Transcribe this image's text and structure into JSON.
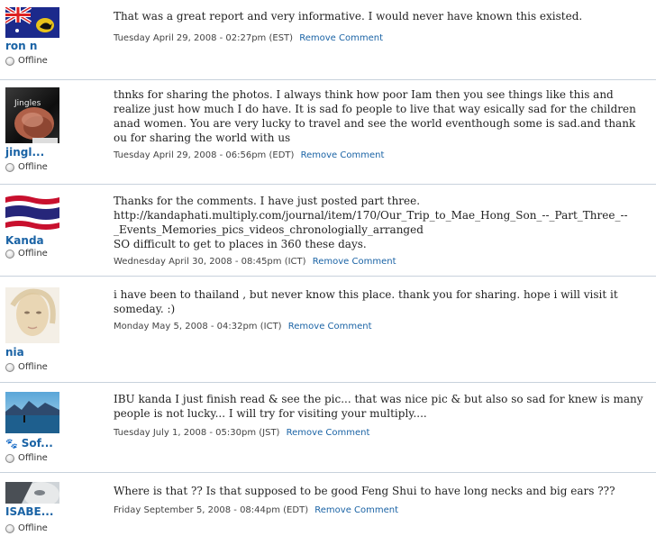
{
  "comments": [
    {
      "username": "ron n",
      "status": "Offline",
      "text": "That was a great report and very informative. I would never have known this existed.",
      "timestamp": "Tuesday April 29, 2008 - 02:27pm (EST)",
      "action": "Remove Comment"
    },
    {
      "username": "jingl...",
      "status": "Offline",
      "text": "thnks for sharing the photos. I always think how poor Iam then you see things like this and realize just how much I do have. It is sad fo people to live that way esically sad for the children anad women. You are very lucky to travel and see the world eventhough some is sad.and thank ou for sharing the world with us",
      "timestamp": "Tuesday April 29, 2008 - 06:56pm (EDT)",
      "action": "Remove Comment",
      "avatar_text": "Jingles"
    },
    {
      "username": "Kanda",
      "status": "Offline",
      "text_lines": [
        "Thanks for the comments. I have just posted part three.",
        "http://kandaphati.multiply.com/journal/item/170/Our_Trip_to_Mae_Hong_Son_--_Part_Three_--",
        "_Events_Memories_pics_videos_chronologially_arranged",
        "SO difficult to get to places in 360 these days."
      ],
      "timestamp": "Wednesday April 30, 2008 - 08:45pm (ICT)",
      "action": "Remove Comment"
    },
    {
      "username": "nia",
      "status": "Offline",
      "text": "i have been to thailand , but never know this place. thank you for sharing. hope i will visit it someday. :)",
      "timestamp": "Monday May 5, 2008 - 04:32pm (ICT)",
      "action": "Remove Comment"
    },
    {
      "username": "Sof...",
      "status": "Offline",
      "text": "IBU kanda I just finish read & see the pic... that was nice pic & but also so sad for knew is many people is not lucky... I will try for visiting your multiply....",
      "timestamp": "Tuesday July 1, 2008 - 05:30pm (JST)",
      "action": "Remove Comment"
    },
    {
      "username": "ISABE...",
      "status": "Offline",
      "text": "Where is that ?? Is that supposed to be good Feng Shui to have long necks and big ears ???",
      "timestamp": "Friday September 5, 2008 - 08:44pm (EDT)",
      "action": "Remove Comment"
    }
  ],
  "colors": {
    "link": "#1a63a5",
    "divider": "#c8d2dc"
  }
}
